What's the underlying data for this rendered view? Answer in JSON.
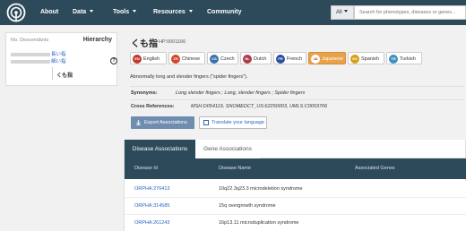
{
  "nav": {
    "items": [
      {
        "label": "About",
        "caret": false
      },
      {
        "label": "Data",
        "caret": true
      },
      {
        "label": "Tools",
        "caret": true
      },
      {
        "label": "Resources",
        "caret": true
      },
      {
        "label": "Community",
        "caret": false
      }
    ],
    "search_scope": "All",
    "search_placeholder": "Search for phenotypes, diseases or genes..."
  },
  "left_panel": {
    "descendants_label": "No. Descendants",
    "hierarchy_title": "Hierarchy",
    "parent_1": "長い指",
    "parent_2": "細い指",
    "help": "?",
    "current": "くも指"
  },
  "term": {
    "name": "くも指",
    "id": "HP:0001166",
    "definition": "Abnormally long and slender fingers (\"spider fingers\").",
    "synonyms_label": "Synonyms:",
    "synonyms": "Long slender fingers ; Long, slender fingers ; Spider fingers",
    "xrefs_label": "Cross References:",
    "xrefs": "MSH:D054119, SNOMEDCT_US:62250003, UMLS:C0003706"
  },
  "languages": [
    {
      "code": "EN",
      "label": "English",
      "color": "#c0392b",
      "active": false
    },
    {
      "code": "ZH",
      "label": "Chinese",
      "color": "#d6452e",
      "active": false
    },
    {
      "code": "CS",
      "label": "Czech",
      "color": "#3a6fb0",
      "active": false
    },
    {
      "code": "NL",
      "label": "Dutch",
      "color": "#b03a48",
      "active": false
    },
    {
      "code": "FR",
      "label": "French",
      "color": "#2b4ea0",
      "active": false
    },
    {
      "code": "JA",
      "label": "Japanese",
      "color": "#ffffff",
      "active": true
    },
    {
      "code": "ES",
      "label": "Spanish",
      "color": "#d4a017",
      "active": false
    },
    {
      "code": "TR",
      "label": "Turkish",
      "color": "#3f8fbf",
      "active": false
    }
  ],
  "buttons": {
    "export": "Export Associations",
    "translate": "Translate your language"
  },
  "tabs": {
    "disease": "Disease Associations",
    "gene": "Gene Associations"
  },
  "table": {
    "headers": [
      "Disease Id",
      "Disease Name",
      "Associated Genes"
    ],
    "rows": [
      {
        "id": "ORPHA:276413",
        "name": "10q22.3q23.3 microdeletion syndrome"
      },
      {
        "id": "ORPHA:314585",
        "name": "15q overgrowth syndrome"
      },
      {
        "id": "ORPHA:261243",
        "name": "16p13.11 microduplication syndrome"
      }
    ]
  }
}
